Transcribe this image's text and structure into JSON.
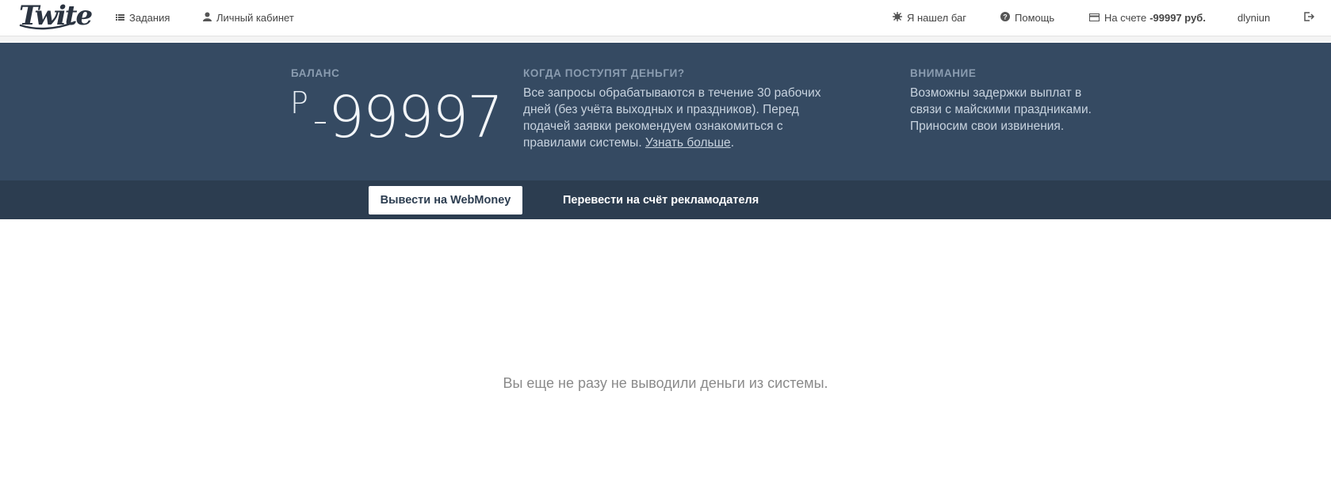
{
  "brand": {
    "logo_text": "Twite"
  },
  "nav": {
    "tasks": "Задания",
    "cabinet": "Личный кабинет",
    "bug": "Я нашел баг",
    "help": "Помощь",
    "account_prefix": "На счете",
    "account_value": "-99997 руб.",
    "username": "dlyniun",
    "icons": {
      "tasks": "list-icon",
      "cabinet": "user-icon",
      "bug": "bug-icon",
      "help": "question-circle-icon",
      "account": "credit-card-icon",
      "logout": "logout-icon"
    }
  },
  "balance": {
    "label": "БАЛАНС",
    "currency_symbol": "Р",
    "amount": "99997",
    "sign": "-"
  },
  "when_money": {
    "label": "КОГДА ПОСТУПЯТ ДЕНЬГИ?",
    "text": "Все запросы обрабатываются в течение 30 рабочих дней (без учёта выходных и праздников). Перед подачей заявки рекомендуем ознакомиться с правилами системы. ",
    "link": "Узнать больше",
    "after_link": "."
  },
  "attention": {
    "label": "ВНИМАНИЕ",
    "text": "Возможны задержки выплат в связи с майскими праздниками. Приносим свои извинения."
  },
  "actions": {
    "withdraw_webmoney": "Вывести на WebMoney",
    "transfer_advertiser": "Перевести на счёт рекламодателя"
  },
  "empty_state": {
    "message": "Вы еще не разу не выводили деньги из системы."
  },
  "colors": {
    "header_band": "#354a62",
    "action_bar": "#2c3d50",
    "label_muted": "#8a9cb0"
  }
}
